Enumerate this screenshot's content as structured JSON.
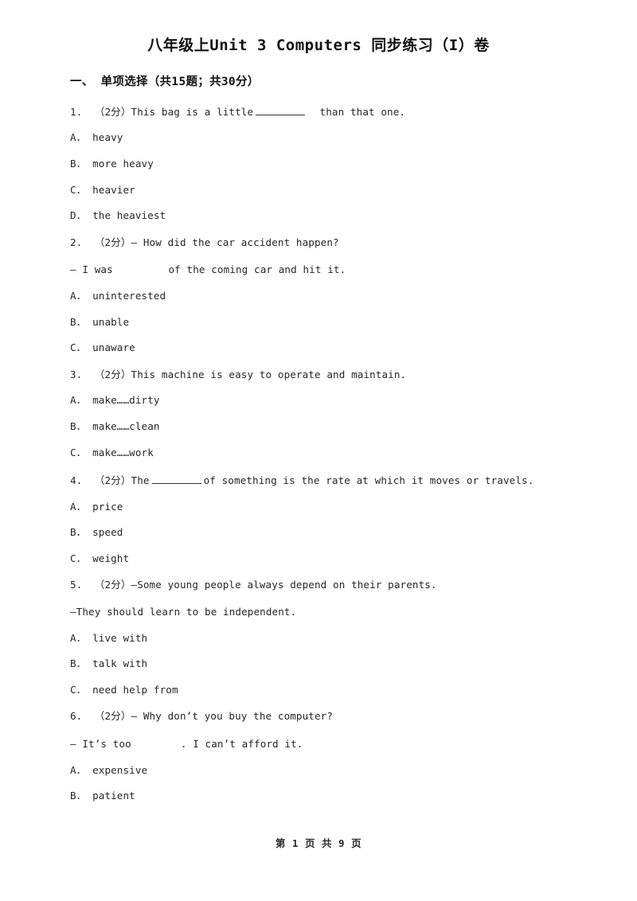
{
  "document": {
    "title": "八年级上Unit 3 Computers 同步练习（I）卷",
    "footer": "第 1 页 共 9 页"
  },
  "sections": [
    {
      "heading": "一、 单项选择（共15题；共30分）"
    }
  ],
  "questions": [
    {
      "number": "1.",
      "score": "（2分）",
      "stem_before": "This bag is a little",
      "blank": "underline",
      "stem_after": "than that one.",
      "options": [
        {
          "letter": "A．",
          "text": "heavy"
        },
        {
          "letter": "B．",
          "text": "more heavy"
        },
        {
          "letter": "C．",
          "text": "heavier"
        },
        {
          "letter": "D．",
          "text": "the heaviest"
        }
      ]
    },
    {
      "number": "2.",
      "score": "（2分）",
      "stem": "— How did the car accident happen?",
      "sub_before": "— I was",
      "blank": "gap",
      "sub_after": "of the coming car and hit it.",
      "options": [
        {
          "letter": "A．",
          "text": "uninterested"
        },
        {
          "letter": "B．",
          "text": "unable"
        },
        {
          "letter": "C．",
          "text": "unaware"
        }
      ]
    },
    {
      "number": "3.",
      "score": "（2分）",
      "stem": "This machine is easy to operate and maintain.",
      "options": [
        {
          "letter": "A．",
          "text": "make……dirty"
        },
        {
          "letter": "B．",
          "text": "make……clean"
        },
        {
          "letter": "C．",
          "text": "make……work"
        }
      ]
    },
    {
      "number": "4.",
      "score": "（2分）",
      "stem_before": "The",
      "blank": "underline",
      "stem_after": "of something is the rate at which it moves or travels.",
      "options": [
        {
          "letter": "A．",
          "text": "price"
        },
        {
          "letter": "B．",
          "text": "speed"
        },
        {
          "letter": "C．",
          "text": "weight"
        }
      ]
    },
    {
      "number": "5.",
      "score": "（2分）",
      "stem": "—Some young people always depend on their parents.",
      "sub": "—They should learn to be independent.",
      "options": [
        {
          "letter": "A．",
          "text": "live with"
        },
        {
          "letter": "B．",
          "text": "talk with"
        },
        {
          "letter": "C．",
          "text": "need help from"
        }
      ]
    },
    {
      "number": "6.",
      "score": "（2分）",
      "stem": "— Why don’t you buy the computer?",
      "sub_before": "— It’s too",
      "blank": "gap",
      "sub_after": ". I can’t afford it.",
      "options": [
        {
          "letter": "A．",
          "text": "expensive"
        },
        {
          "letter": "B．",
          "text": "patient"
        }
      ]
    }
  ]
}
